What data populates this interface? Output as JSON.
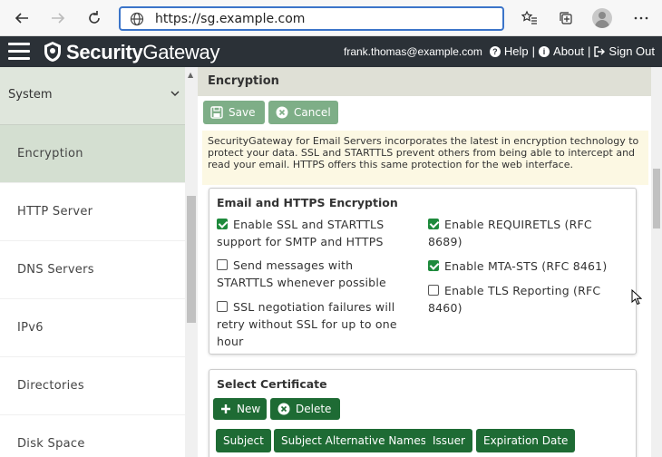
{
  "browser": {
    "url": "https://sg.example.com",
    "back_icon": "back-arrow-icon",
    "forward_icon": "forward-arrow-icon",
    "refresh_icon": "refresh-icon"
  },
  "header": {
    "logo_bold": "Security",
    "logo_light": "Gateway",
    "user": "frank.thomas@example.com",
    "help": "Help",
    "about": "About",
    "signout": "Sign Out",
    "bg_color": "#2b3137"
  },
  "sidebar": {
    "section": "System",
    "items": [
      {
        "label": "Encryption",
        "active": true
      },
      {
        "label": "HTTP Server"
      },
      {
        "label": "DNS Servers"
      },
      {
        "label": "IPv6"
      },
      {
        "label": "Directories"
      },
      {
        "label": "Disk Space"
      }
    ]
  },
  "main": {
    "title": "Encryption",
    "save_label": "Save",
    "cancel_label": "Cancel",
    "intro": "SecurityGateway for Email Servers incorporates the latest in encryption technology to protect your data. SSL and STARTTLS prevent others from being able to intercept and read your email. HTTPS offers this same protection for the web interface.",
    "encryption_card": {
      "title": "Email and HTTPS Encryption",
      "options": [
        {
          "label": "Enable SSL and STARTTLS support for SMTP and HTTPS",
          "checked": true
        },
        {
          "label": "Send messages with STARTTLS whenever possible",
          "checked": false
        },
        {
          "label": "SSL negotiation failures will retry without SSL for up to one hour",
          "checked": false
        },
        {
          "label": "Enable REQUIRETLS (RFC 8689)",
          "checked": true
        },
        {
          "label": "Enable MTA-STS (RFC 8461)",
          "checked": true
        },
        {
          "label": "Enable TLS Reporting (RFC 8460)",
          "checked": false
        }
      ]
    },
    "certificate_card": {
      "title": "Select Certificate",
      "new_label": "New",
      "delete_label": "Delete",
      "columns": [
        "Subject",
        "Subject Alternative Names",
        "Issuer",
        "Expiration Date"
      ]
    }
  },
  "colors": {
    "accent_dark": "#1e6b34",
    "accent_light": "#7eae87",
    "checkbox": "#1e8a3c"
  }
}
